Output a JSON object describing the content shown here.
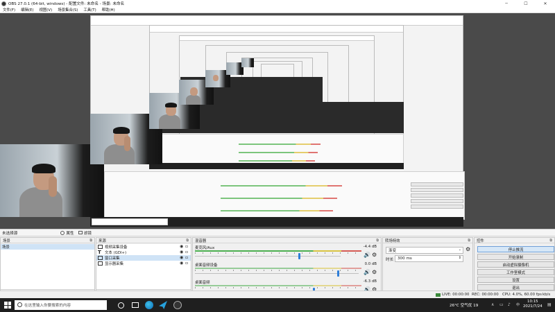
{
  "window": {
    "title": "OBS 27.0.1 (64-bit, windows) - 配置文件: 未命名 - 场景: 未命名",
    "controls": [
      "─",
      "☐",
      "✕"
    ]
  },
  "menu": [
    "文件(F)",
    "编辑(E)",
    "视图(V)",
    "场景集合(S)",
    "工具(T)",
    "帮助(H)"
  ],
  "studio_bar": {
    "label": "未选择源",
    "filters_label": "属性",
    "filters2_label": "滤镜"
  },
  "scenes": {
    "title": "场景",
    "items": [
      "场景"
    ]
  },
  "sources": {
    "title": "来源",
    "items": [
      {
        "label": "视频采集设备",
        "icon": "camera-icon"
      },
      {
        "label": "文本 (GDI+)",
        "icon": "text-icon"
      },
      {
        "label": "窗口采集",
        "icon": "window-icon"
      },
      {
        "label": "显示器采集",
        "icon": "monitor-icon"
      }
    ]
  },
  "mixer": {
    "title": "混音器",
    "tracks": [
      {
        "name": "麦克风/Aux",
        "db": "-4.4 dB",
        "level": 0.63
      },
      {
        "name": "桌面音频设备",
        "db": "0.0 dB",
        "level": 0.87
      },
      {
        "name": "桌面音频",
        "db": "-6.3 dB",
        "level": 0.72
      }
    ]
  },
  "transitions": {
    "title": "转场特效",
    "selected": "渐变",
    "duration_label": "时长",
    "duration_value": "300 ms"
  },
  "controls": {
    "title": "控件",
    "buttons": [
      "停止推流",
      "开始录制",
      "启动虚拟摄像机",
      "工作室模式",
      "设置",
      "退出"
    ]
  },
  "status": {
    "live": "LIVE: 00:00:00",
    "rec": "REC: 00:00:00",
    "cpu": "CPU: 4.0%, 60.00 fps",
    "kbps": "kb/s"
  },
  "taskbar": {
    "search_placeholder": "在这里输入你要搜索的内容",
    "weather": "26°C 空气优 19",
    "time": "10:15",
    "date": "2021/7/24"
  },
  "colors": {
    "accent": "#2f7ed8",
    "meter_green": "#4caf50",
    "meter_yellow": "#d9c442",
    "meter_red": "#d55a54"
  }
}
